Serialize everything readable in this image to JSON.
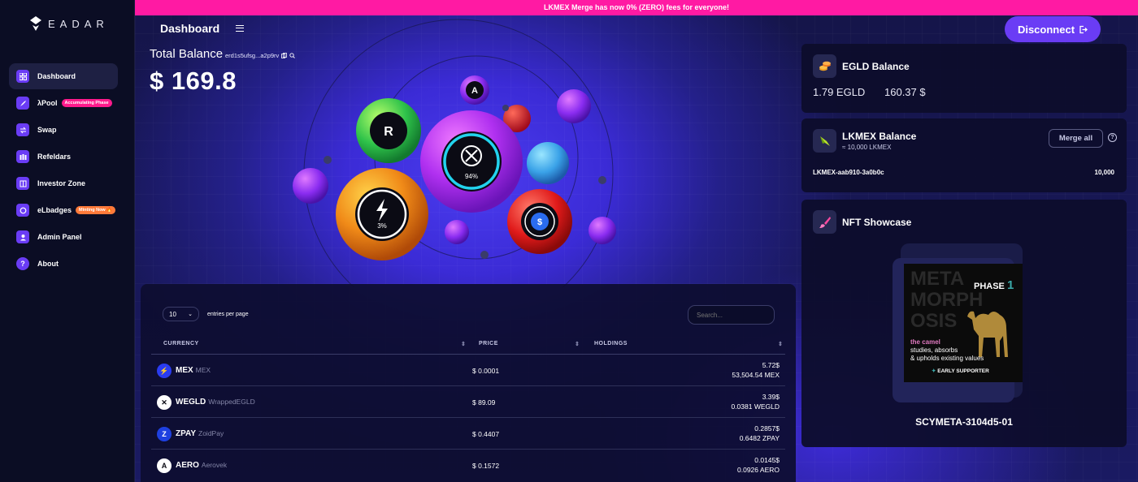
{
  "app": {
    "logo_text": "EADAR"
  },
  "banner": {
    "text": "LKMEX Merge has now 0% (ZERO) fees for everyone!"
  },
  "sidebar": {
    "items": [
      {
        "label": "Dashboard",
        "icon": "dashboard-icon",
        "active": true
      },
      {
        "label": "λPool",
        "icon": "rocket-icon",
        "badge": "Accumulating Phase"
      },
      {
        "label": "Swap",
        "icon": "swap-icon"
      },
      {
        "label": "Refeldars",
        "icon": "users-icon"
      },
      {
        "label": "Investor Zone",
        "icon": "building-icon"
      },
      {
        "label": "eLbadges",
        "icon": "badge-icon",
        "badge": "Minting Now 🔥"
      },
      {
        "label": "Admin Panel",
        "icon": "admin-icon"
      },
      {
        "label": "About",
        "icon": "question-icon"
      }
    ]
  },
  "header": {
    "title": "Dashboard",
    "disconnect_label": "Disconnect"
  },
  "balance": {
    "label": "Total Balance",
    "address": "erd1s5ufsg...a2p9rv",
    "value": "$ 169.8"
  },
  "bubbles": {
    "mex_percent": "3%",
    "egld_percent": "94%"
  },
  "table": {
    "entries_value": "10",
    "entries_label": "entries per page",
    "search_placeholder": "Search...",
    "headers": {
      "currency": "CURRENCY",
      "price": "PRICE",
      "holdings": "HOLDINGS"
    },
    "rows": [
      {
        "symbol": "MEX",
        "name": "MEX",
        "price": "$ 0.0001",
        "usd": "5.72$",
        "amount": "53,504.54 MEX",
        "icon_color": "#2a3cf0",
        "icon_text": "⚡"
      },
      {
        "symbol": "WEGLD",
        "name": "WrappedEGLD",
        "price": "$ 89.09",
        "usd": "3.39$",
        "amount": "0.0381 WEGLD",
        "icon_color": "#ffffff",
        "icon_text": "✕"
      },
      {
        "symbol": "ZPAY",
        "name": "ZoidPay",
        "price": "$ 0.4407",
        "usd": "0.2857$",
        "amount": "0.6482 ZPAY",
        "icon_color": "#1e40e0",
        "icon_text": "Z"
      },
      {
        "symbol": "AERO",
        "name": "Aerovek",
        "price": "$ 0.1572",
        "usd": "0.0145$",
        "amount": "0.0926 AERO",
        "icon_color": "#ffffff",
        "icon_text": "A"
      }
    ]
  },
  "egld": {
    "title": "EGLD Balance",
    "amount": "1.79 EGLD",
    "usd": "160.37 $"
  },
  "lkmex": {
    "title": "LKMEX Balance",
    "subtitle": "≈ 10,000 LKMEX",
    "merge_label": "Merge all",
    "help": "?",
    "token_id": "LKMEX-aab910-3a0b0c",
    "token_amount": "10,000"
  },
  "nft": {
    "title": "NFT Showcase",
    "art_big": [
      "META",
      "MORPH",
      "OSIS"
    ],
    "art_phase": "PHASE",
    "art_phase_num": "1",
    "art_line1": "the camel",
    "art_line2": "studies, absorbs",
    "art_line3": "& upholds existing values",
    "art_footer": "EARLY SUPPORTER",
    "name": "SCYMETA-3104d5-01"
  }
}
